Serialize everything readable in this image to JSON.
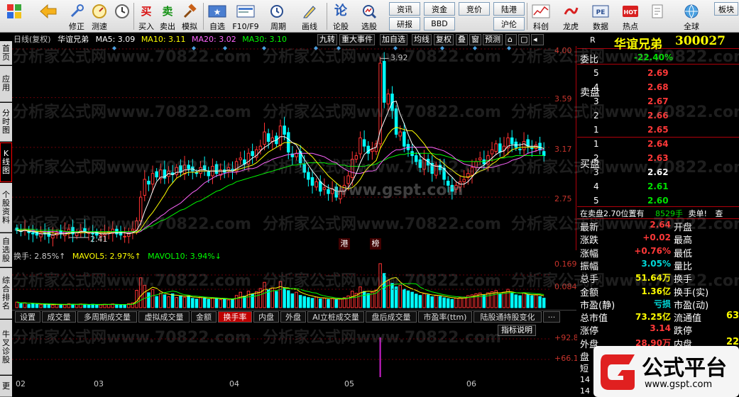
{
  "toolbar": {
    "items": [
      {
        "label": "",
        "icon": "windows-icon"
      },
      {
        "label": "",
        "icon": "back-arrow-icon"
      },
      {
        "label": "修正",
        "icon": "fix-icon"
      },
      {
        "label": "测速",
        "icon": "speed-icon"
      },
      {
        "label": "买入",
        "icon": "buy-icon",
        "glyph": "买"
      },
      {
        "label": "卖出",
        "icon": "sell-icon",
        "glyph": "卖"
      },
      {
        "label": "模拟",
        "icon": "hammer-icon"
      },
      {
        "label": "自选",
        "icon": "star-icon"
      },
      {
        "label": "F10/F9",
        "icon": "f10-icon"
      },
      {
        "label": "周期",
        "icon": "clock-icon"
      },
      {
        "label": "画线",
        "icon": "pencil-icon"
      },
      {
        "label": "论股",
        "icon": "discuss-icon"
      },
      {
        "label": "选股",
        "icon": "search-chart-icon"
      },
      {
        "label": "科创",
        "icon": "sci-icon"
      },
      {
        "label": "龙虎",
        "icon": "dragon-icon"
      },
      {
        "label": "数据",
        "icon": "pe-icon"
      },
      {
        "label": "热点",
        "icon": "hot-icon"
      },
      {
        "label": "全球",
        "icon": "globe-icon"
      }
    ],
    "small_buttons": [
      {
        "label": "资讯"
      },
      {
        "label": "资金"
      },
      {
        "label": "竞价"
      },
      {
        "label": "陆港"
      },
      {
        "label": "研报"
      },
      {
        "label": "BBD"
      },
      {
        "label": "沪伦"
      }
    ],
    "last": "板块"
  },
  "sidebar": {
    "tabs": [
      {
        "label": "首页"
      },
      {
        "label": "应用"
      },
      {
        "label": "分时图"
      },
      {
        "label": "K线图"
      },
      {
        "label": "个股资料"
      },
      {
        "label": "自选股"
      },
      {
        "label": "综合排名"
      },
      {
        "label": "牛叉诊股"
      },
      {
        "label": "更"
      }
    ]
  },
  "chart_header": {
    "period": "日线(复权)",
    "name": "华谊兄弟",
    "ma5": "MA5: 3.09",
    "ma10": "MA10: 3.11",
    "ma20": "MA20: 3.02",
    "ma30": "MA30: 3.10",
    "buttons": [
      "九转",
      "重大事件",
      "加自选",
      "均线",
      "复权",
      "叠",
      "窗",
      "预测"
    ]
  },
  "chart_data": {
    "type": "candlestick",
    "title": "华谊兄弟 300027",
    "y_ticks": [
      "4.00",
      "3.59",
      "3.17",
      "2.75"
    ],
    "high_label": "3.92",
    "low_label": "2.41",
    "x_ticks": [
      "02",
      "03",
      "04",
      "05",
      "06"
    ],
    "close_series": [
      2.47,
      2.46,
      2.48,
      2.45,
      2.44,
      2.43,
      2.45,
      2.44,
      2.42,
      2.43,
      2.45,
      2.44,
      2.46,
      2.48,
      2.44,
      2.45,
      2.47,
      2.46,
      2.45,
      2.44,
      2.43,
      2.43,
      2.44,
      2.46,
      2.48,
      2.44,
      2.43,
      2.42,
      2.45,
      2.48,
      2.55,
      2.75,
      2.9,
      2.86,
      2.95,
      2.92,
      2.98,
      2.91,
      2.97,
      2.94,
      3.0,
      2.96,
      3.02,
      2.99,
      2.97,
      2.95,
      3.0,
      2.98,
      2.93,
      3.01,
      2.95,
      2.98,
      2.96,
      3.0,
      2.97,
      3.05,
      3.08,
      3.03,
      3.12,
      3.1,
      3.15,
      3.18,
      3.3,
      3.22,
      3.25,
      3.2,
      3.35,
      3.28,
      3.13,
      3.09,
      3.12,
      3.04,
      2.96,
      2.9,
      2.85,
      2.88,
      2.8,
      2.83,
      2.78,
      2.82,
      2.75,
      2.8,
      2.85,
      2.93,
      3.07,
      3.1,
      3.25,
      3.18,
      3.12,
      3.15,
      3.2,
      3.88,
      3.55,
      3.62,
      3.48,
      3.28,
      3.3,
      3.18,
      3.15,
      3.1,
      3.05,
      3.0,
      3.07,
      3.02,
      2.95,
      3.02,
      2.98,
      2.9,
      2.85,
      2.8,
      2.85,
      2.88,
      2.9,
      2.95,
      3.0,
      3.05,
      3.08,
      3.03,
      3.1,
      3.15,
      3.2,
      3.13,
      3.18,
      3.25,
      3.2,
      3.17,
      3.15,
      3.22,
      3.18,
      3.16,
      3.19,
      3.15,
      3.1
    ],
    "ma5": [
      2.47,
      2.46,
      2.47,
      2.46,
      2.46,
      2.45,
      2.44,
      2.44,
      2.44,
      2.43,
      2.44,
      2.44,
      2.44,
      2.45,
      2.45,
      2.45,
      2.46,
      2.46,
      2.45,
      2.45,
      2.45,
      2.44,
      2.44,
      2.44,
      2.45,
      2.45,
      2.45,
      2.45,
      2.44,
      2.45,
      2.47,
      2.53,
      2.63,
      2.71,
      2.8,
      2.88,
      2.92,
      2.92,
      2.95,
      2.94,
      2.96,
      2.96,
      2.98,
      2.98,
      2.99,
      2.97,
      2.98,
      2.98,
      2.97,
      2.97,
      2.97,
      2.97,
      2.97,
      2.98,
      2.97,
      2.99,
      3.01,
      3.03,
      3.05,
      3.08,
      3.1,
      3.14,
      3.17,
      3.19,
      3.22,
      3.23,
      3.26,
      3.26,
      3.24,
      3.21,
      3.19,
      3.13,
      3.07,
      3.02,
      2.97,
      2.93,
      2.88,
      2.85,
      2.83,
      2.82,
      2.8,
      2.8,
      2.8,
      2.83,
      2.88,
      2.95,
      3.04,
      3.11,
      3.14,
      3.16,
      3.17,
      3.31,
      3.39,
      3.47,
      3.55,
      3.56,
      3.45,
      3.37,
      3.28,
      3.2,
      3.16,
      3.1,
      3.07,
      3.05,
      3.02,
      3.01,
      3.01,
      2.99,
      2.95,
      2.92,
      2.88,
      2.86,
      2.86,
      2.88,
      2.92,
      2.96,
      3.0,
      3.02,
      3.05,
      3.08,
      3.11,
      3.13,
      3.14,
      3.18,
      3.19,
      3.19,
      3.19,
      3.2,
      3.18,
      3.18,
      3.18,
      3.17,
      3.16
    ],
    "ma10": [
      2.47,
      2.47,
      2.47,
      2.47,
      2.46,
      2.46,
      2.46,
      2.45,
      2.45,
      2.45,
      2.44,
      2.44,
      2.44,
      2.44,
      2.45,
      2.45,
      2.45,
      2.45,
      2.45,
      2.45,
      2.45,
      2.45,
      2.45,
      2.45,
      2.45,
      2.45,
      2.45,
      2.45,
      2.44,
      2.45,
      2.45,
      2.48,
      2.53,
      2.58,
      2.62,
      2.67,
      2.72,
      2.77,
      2.83,
      2.87,
      2.91,
      2.93,
      2.95,
      2.96,
      2.96,
      2.96,
      2.97,
      2.97,
      2.97,
      2.97,
      2.97,
      2.97,
      2.97,
      2.97,
      2.97,
      2.98,
      2.99,
      3.0,
      3.01,
      3.02,
      3.04,
      3.07,
      3.1,
      3.13,
      3.15,
      3.17,
      3.19,
      3.21,
      3.21,
      3.21,
      3.2,
      3.18,
      3.15,
      3.12,
      3.09,
      3.05,
      3.01,
      2.97,
      2.93,
      2.9,
      2.87,
      2.84,
      2.83,
      2.82,
      2.83,
      2.86,
      2.9,
      2.96,
      3.0,
      3.03,
      3.06,
      3.16,
      3.22,
      3.28,
      3.32,
      3.34,
      3.33,
      3.32,
      3.31,
      3.31,
      3.28,
      3.24,
      3.2,
      3.15,
      3.11,
      3.08,
      3.06,
      3.03,
      3.0,
      2.98,
      2.95,
      2.93,
      2.92,
      2.92,
      2.93,
      2.95,
      2.97,
      2.98,
      3.0,
      3.03,
      3.05,
      3.08,
      3.09,
      3.12,
      3.15,
      3.16,
      3.17,
      3.17,
      3.17,
      3.17,
      3.17,
      3.17,
      3.16
    ],
    "ma20": [
      2.47,
      2.47,
      2.47,
      2.47,
      2.47,
      2.46,
      2.46,
      2.46,
      2.46,
      2.46,
      2.46,
      2.45,
      2.45,
      2.45,
      2.45,
      2.45,
      2.45,
      2.45,
      2.45,
      2.45,
      2.45,
      2.45,
      2.45,
      2.45,
      2.45,
      2.45,
      2.45,
      2.45,
      2.45,
      2.45,
      2.45,
      2.46,
      2.49,
      2.51,
      2.54,
      2.56,
      2.59,
      2.61,
      2.64,
      2.66,
      2.68,
      2.7,
      2.73,
      2.76,
      2.79,
      2.81,
      2.84,
      2.87,
      2.89,
      2.91,
      2.93,
      2.94,
      2.95,
      2.96,
      2.96,
      2.96,
      2.97,
      2.98,
      2.99,
      2.99,
      3.0,
      3.02,
      3.04,
      3.05,
      3.07,
      3.08,
      3.09,
      3.1,
      3.11,
      3.11,
      3.12,
      3.12,
      3.12,
      3.12,
      3.12,
      3.11,
      3.1,
      3.09,
      3.07,
      3.05,
      3.04,
      3.01,
      2.99,
      2.97,
      2.96,
      2.95,
      2.95,
      2.96,
      2.97,
      2.97,
      2.98,
      3.03,
      3.07,
      3.1,
      3.13,
      3.15,
      3.15,
      3.16,
      3.17,
      3.17,
      3.17,
      3.17,
      3.17,
      3.17,
      3.17,
      3.16,
      3.15,
      3.14,
      3.12,
      3.1,
      3.07,
      3.05,
      3.03,
      3.02,
      3.01,
      3.0,
      3.0,
      3.0,
      3.0,
      3.0,
      3.01,
      3.02,
      3.03,
      3.04,
      3.06,
      3.07,
      3.08,
      3.1,
      3.12,
      3.13,
      3.14,
      3.15,
      3.15
    ],
    "ma30": [
      2.48,
      2.48,
      2.48,
      2.48,
      2.48,
      2.47,
      2.47,
      2.47,
      2.47,
      2.47,
      2.47,
      2.47,
      2.46,
      2.46,
      2.46,
      2.46,
      2.46,
      2.46,
      2.46,
      2.46,
      2.46,
      2.46,
      2.46,
      2.46,
      2.46,
      2.46,
      2.46,
      2.46,
      2.46,
      2.46,
      2.46,
      2.47,
      2.48,
      2.5,
      2.51,
      2.53,
      2.55,
      2.56,
      2.58,
      2.6,
      2.62,
      2.64,
      2.65,
      2.67,
      2.69,
      2.71,
      2.72,
      2.74,
      2.76,
      2.78,
      2.8,
      2.81,
      2.83,
      2.85,
      2.86,
      2.88,
      2.89,
      2.9,
      2.91,
      2.92,
      2.93,
      2.94,
      2.95,
      2.96,
      2.97,
      2.98,
      2.99,
      3.0,
      3.01,
      3.02,
      3.02,
      3.03,
      3.03,
      3.04,
      3.04,
      3.04,
      3.04,
      3.04,
      3.03,
      3.03,
      3.03,
      3.02,
      3.02,
      3.01,
      3.01,
      3.01,
      3.01,
      3.01,
      3.02,
      3.02,
      3.03,
      3.05,
      3.06,
      3.08,
      3.09,
      3.1,
      3.11,
      3.11,
      3.12,
      3.12,
      3.12,
      3.12,
      3.12,
      3.12,
      3.12,
      3.11,
      3.11,
      3.1,
      3.09,
      3.08,
      3.07,
      3.06,
      3.05,
      3.05,
      3.05,
      3.05,
      3.05,
      3.05,
      3.06,
      3.06,
      3.07,
      3.08,
      3.08,
      3.09,
      3.09,
      3.1,
      3.1,
      3.1,
      3.1,
      3.1,
      3.1,
      3.1,
      3.1
    ],
    "y_min": 2.35,
    "y_max": 4.0,
    "markers": [
      {
        "label": "港"
      },
      {
        "label": "榜"
      }
    ]
  },
  "volume_header": {
    "turnover": "换手: 2.85%↑",
    "mavol5": "MAVOL5: 2.97%↑",
    "mavol10": "MAVOL10: 3.94%↓"
  },
  "volume_chart": {
    "y_ticks": [
      "0.169",
      "0.084"
    ],
    "values": [
      2.1,
      1.5,
      1.8,
      1.2,
      1.6,
      1.3,
      1.1,
      1.4,
      1.2,
      1.0,
      1.3,
      1.2,
      1.1,
      1.5,
      1.3,
      1.2,
      1.4,
      1.1,
      1.0,
      1.3,
      1.2,
      1.1,
      1.3,
      1.2,
      1.4,
      1.1,
      1.0,
      1.2,
      1.5,
      1.8,
      6.5,
      11.2,
      8.4,
      5.6,
      6.8,
      4.2,
      5.5,
      4.8,
      4.1,
      5.2,
      3.8,
      4.5,
      3.9,
      4.4,
      3.5,
      3.2,
      4.0,
      3.6,
      3.1,
      3.8,
      3.3,
      3.0,
      3.4,
      2.9,
      3.2,
      4.6,
      5.8,
      4.3,
      6.2,
      5.1,
      6.0,
      7.2,
      9.5,
      6.8,
      7.4,
      6.1,
      9.8,
      7.3,
      6.4,
      5.2,
      5.8,
      4.6,
      4.2,
      3.8,
      3.5,
      4.0,
      3.3,
      3.6,
      3.1,
      3.4,
      3.0,
      3.2,
      3.8,
      4.4,
      6.2,
      5.4,
      7.8,
      6.1,
      5.3,
      5.8,
      6.6,
      16.5,
      12.8,
      10.2,
      9.1,
      7.8,
      8.4,
      6.9,
      6.3,
      5.8,
      5.1,
      4.6,
      5.3,
      4.8,
      4.1,
      4.6,
      4.2,
      3.7,
      3.4,
      3.1,
      3.6,
      3.8,
      4.0,
      4.5,
      4.8,
      5.2,
      5.5,
      4.6,
      5.6,
      6.0,
      6.4,
      5.1,
      5.8,
      6.9,
      5.4,
      4.8,
      4.5,
      5.6,
      4.9,
      4.5,
      4.8,
      4.2,
      3.6
    ]
  },
  "bottom_tabs": [
    {
      "label": "设置"
    },
    {
      "label": "成交量"
    },
    {
      "label": "多周期成交量"
    },
    {
      "label": "虚拟成交量"
    },
    {
      "label": "金额"
    },
    {
      "label": "换手率"
    },
    {
      "label": "内盘"
    },
    {
      "label": "外盘"
    },
    {
      "label": "AI立桩成交量"
    },
    {
      "label": "盘后成交量"
    },
    {
      "label": "市盈率(ttm)"
    },
    {
      "label": "陆股通持股变化"
    },
    {
      "label": "···"
    }
  ],
  "indicator": {
    "button": "指标说明",
    "y_ticks": [
      "+92.88",
      "+66.10"
    ]
  },
  "right_panel": {
    "top_mark": "R",
    "stock_name": "华谊兄弟",
    "stock_code": "300027",
    "weibi_label": "委比",
    "weibi_value": "-22.40%",
    "sell_label": "卖盘",
    "buy_label": "买盘",
    "sell_levels": [
      {
        "level": "5",
        "price": "2.69"
      },
      {
        "level": "4",
        "price": "2.68"
      },
      {
        "level": "3",
        "price": "2.67"
      },
      {
        "level": "2",
        "price": "2.66"
      },
      {
        "level": "1",
        "price": "2.65"
      }
    ],
    "buy_levels": [
      {
        "level": "1",
        "price": "2.64"
      },
      {
        "level": "2",
        "price": "2.63"
      },
      {
        "level": "3",
        "price": "2.62"
      },
      {
        "level": "4",
        "price": "2.61"
      },
      {
        "level": "5",
        "price": "2.60"
      }
    ],
    "note_left": "在卖盘2.70位置有",
    "note_qty": "8529手",
    "note_right": "卖单!",
    "note_end": "查",
    "stats": [
      {
        "label": "最新",
        "value": "2.64",
        "label2": "开盘",
        "value2": ""
      },
      {
        "label": "涨跌",
        "value": "+0.02",
        "label2": "最高",
        "value2": ""
      },
      {
        "label": "涨幅",
        "value": "+0.76%",
        "label2": "最低",
        "value2": ""
      },
      {
        "label": "振幅",
        "value": "3.05%",
        "label2": "量比",
        "value2": ""
      },
      {
        "label": "总手",
        "value": "51.64万",
        "label2": "换手",
        "value2": ""
      },
      {
        "label": "金额",
        "value": "1.36亿",
        "label2": "换手(实)",
        "value2": ""
      },
      {
        "label": "市盈(静)",
        "value": "亏损",
        "label2": "市盈(动)",
        "value2": ""
      },
      {
        "label": "总市值",
        "value": "73.25亿",
        "label2": "流通值",
        "value2": "63"
      },
      {
        "label": "涨停",
        "value": "3.14",
        "label2": "跌停",
        "value2": ""
      },
      {
        "label": "外盘",
        "value": "28.90万",
        "label2": "内盘",
        "value2": "22"
      },
      {
        "label": "盘",
        "value": "",
        "label2": "",
        "value2": ""
      }
    ],
    "bottom_label": "短",
    "bottom_numbers": [
      "14",
      "14"
    ]
  },
  "logo": {
    "name": "公式平台",
    "url": "www.gspt.com"
  },
  "watermarks": [
    "分析家公式网www.70822.com",
    "www.gspt.com"
  ],
  "colors": {
    "up": "#ff3333",
    "down": "#00ffff",
    "ma5": "#ffffff",
    "ma10": "#ffff00",
    "ma20": "#ff66ff",
    "ma30": "#00ff00",
    "frame": "#b0000a"
  }
}
